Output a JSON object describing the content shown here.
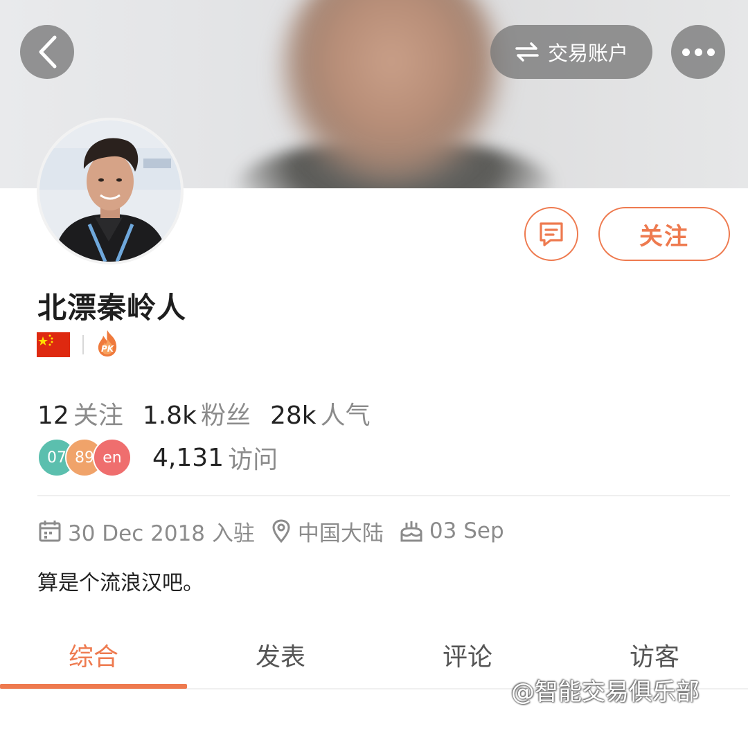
{
  "header": {
    "account_switch_label": "交易账户"
  },
  "profile": {
    "username": "北漂秦岭人",
    "follow_label": "关注",
    "pk_badge_text": "PK"
  },
  "stats": [
    {
      "value": "12",
      "label": "关注"
    },
    {
      "value": "1.8k",
      "label": "粉丝"
    },
    {
      "value": "28k",
      "label": "人气"
    }
  ],
  "visitors": {
    "bubbles": [
      {
        "text": "07",
        "color": "#5bbfae"
      },
      {
        "text": "89",
        "color": "#f0a36a"
      },
      {
        "text": "en",
        "color": "#ef6e6e"
      }
    ],
    "count": "4,131",
    "label": "访问"
  },
  "meta": {
    "joined": "30 Dec 2018 入驻",
    "location": "中国大陆",
    "birthday": "03 Sep"
  },
  "bio": "算是个流浪汉吧。",
  "tabs": [
    {
      "label": "综合",
      "active": true
    },
    {
      "label": "发表",
      "active": false
    },
    {
      "label": "评论",
      "active": false
    },
    {
      "label": "访客",
      "active": false
    }
  ],
  "watermark": "@智能交易俱乐部",
  "colors": {
    "accent": "#ee7a4f",
    "muted_text": "#8b8b8b"
  }
}
